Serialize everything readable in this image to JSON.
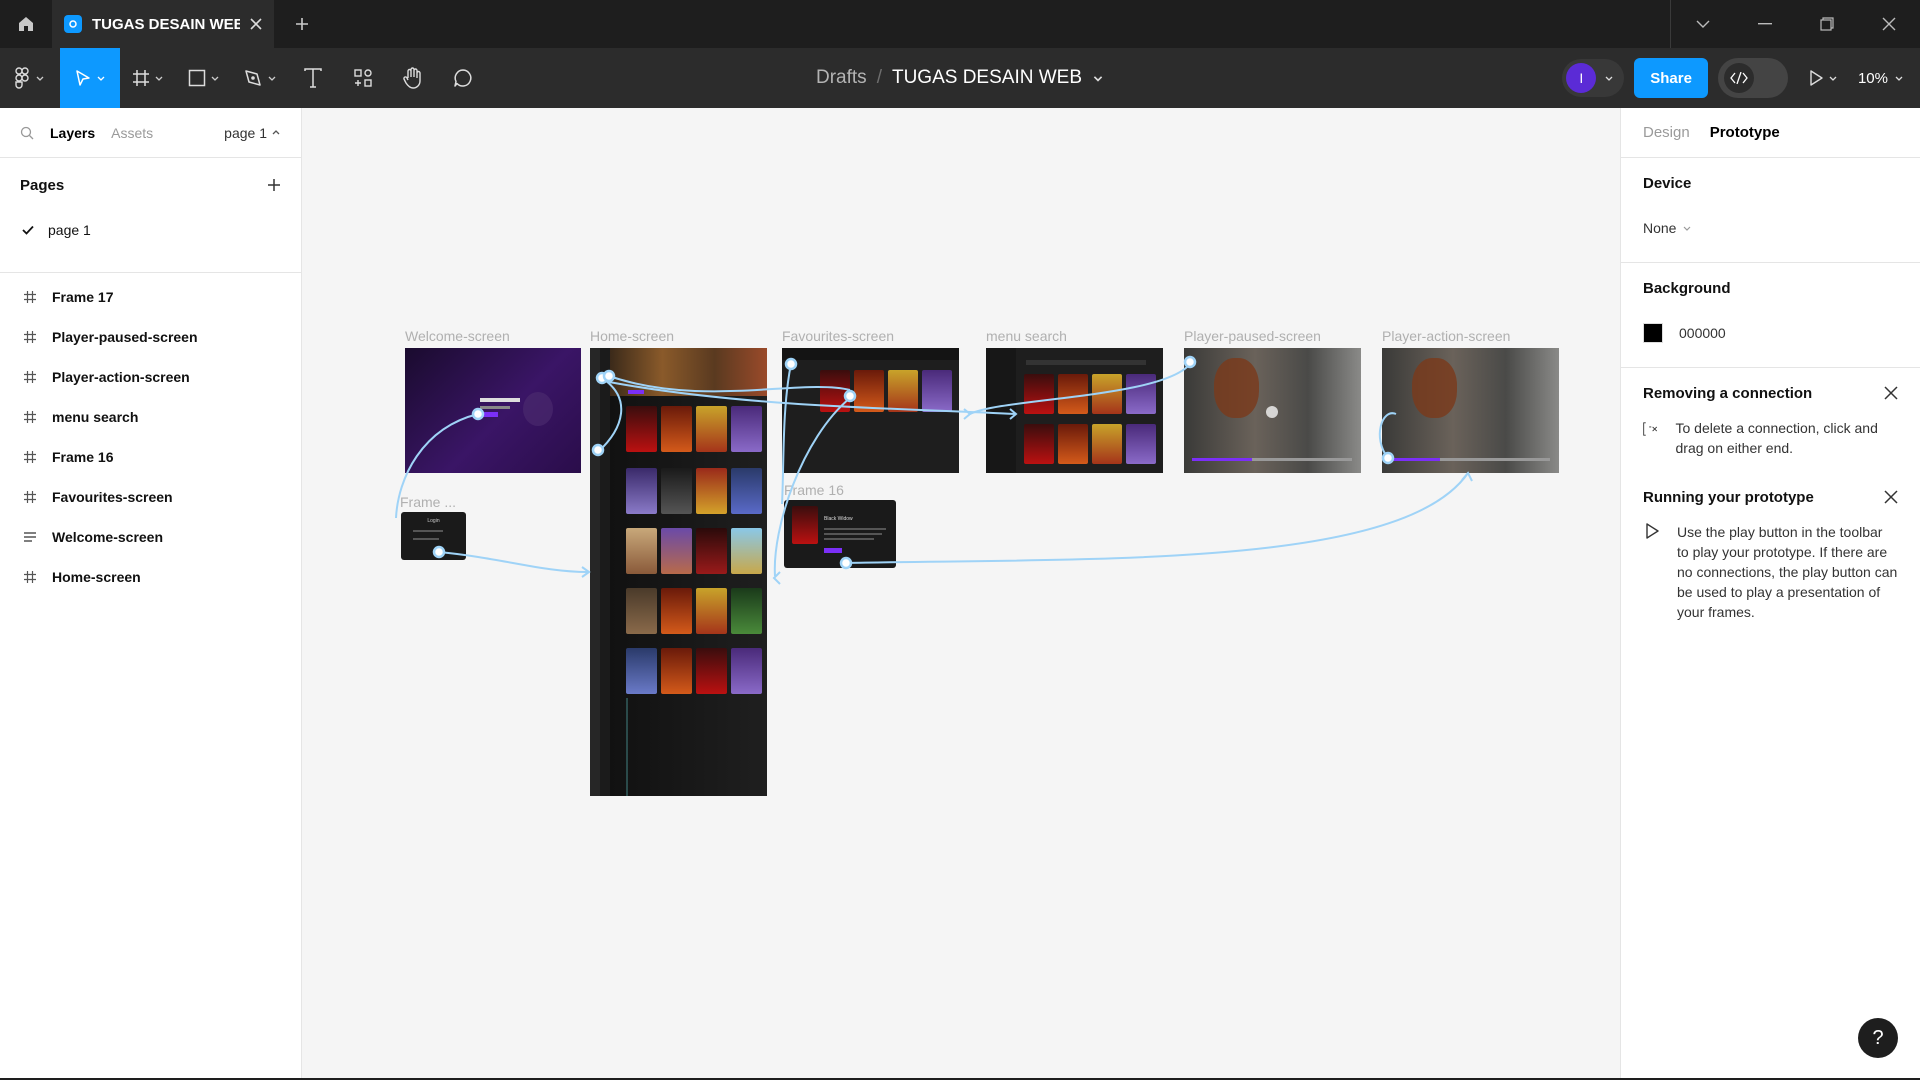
{
  "titlebar": {
    "tab_title": "TUGAS DESAIN WEB"
  },
  "toolbar": {
    "crumb_drafts": "Drafts",
    "crumb_separator": "/",
    "file_name": "TUGAS DESAIN WEB",
    "avatar_initial": "I",
    "share_label": "Share",
    "zoom_label": "10%"
  },
  "left_panel": {
    "tab_layers": "Layers",
    "tab_assets": "Assets",
    "page_selector": "page 1",
    "pages_header": "Pages",
    "pages": [
      "page 1"
    ],
    "layers": [
      {
        "name": "Frame 17",
        "icon": "frame-icon"
      },
      {
        "name": "Player-paused-screen",
        "icon": "frame-icon"
      },
      {
        "name": "Player-action-screen",
        "icon": "frame-icon"
      },
      {
        "name": "menu search",
        "icon": "frame-icon"
      },
      {
        "name": "Frame 16",
        "icon": "frame-icon"
      },
      {
        "name": "Favourites-screen",
        "icon": "frame-icon"
      },
      {
        "name": "Welcome-screen",
        "icon": "auto-layout-icon"
      },
      {
        "name": "Home-screen",
        "icon": "frame-icon"
      }
    ]
  },
  "right_panel": {
    "tab_design": "Design",
    "tab_prototype": "Prototype",
    "device_header": "Device",
    "device_value": "None",
    "background_header": "Background",
    "background_hex": "000000",
    "tip1_title": "Removing a connection",
    "tip1_text": "To delete a connection, click and drag on either end.",
    "tip2_title": "Running your prototype",
    "tip2_text": "Use the play button in the toolbar to play your prototype. If there are no connections, the play button can be used to play a presentation of your frames.",
    "help_label": "?"
  },
  "canvas": {
    "frames": {
      "welcome": "Welcome-screen",
      "home": "Home-screen",
      "favourites": "Favourites-screen",
      "menu_search": "menu search",
      "player_paused": "Player-paused-screen",
      "player_action": "Player-action-screen",
      "frame17": "Frame ...",
      "frame16": "Frame 16"
    },
    "login_label": "Login",
    "movie_title": "Black Widow"
  },
  "colors": {
    "accent": "#0d99ff",
    "connector": "#9fd3f7",
    "avatar": "#5b2bd6"
  }
}
